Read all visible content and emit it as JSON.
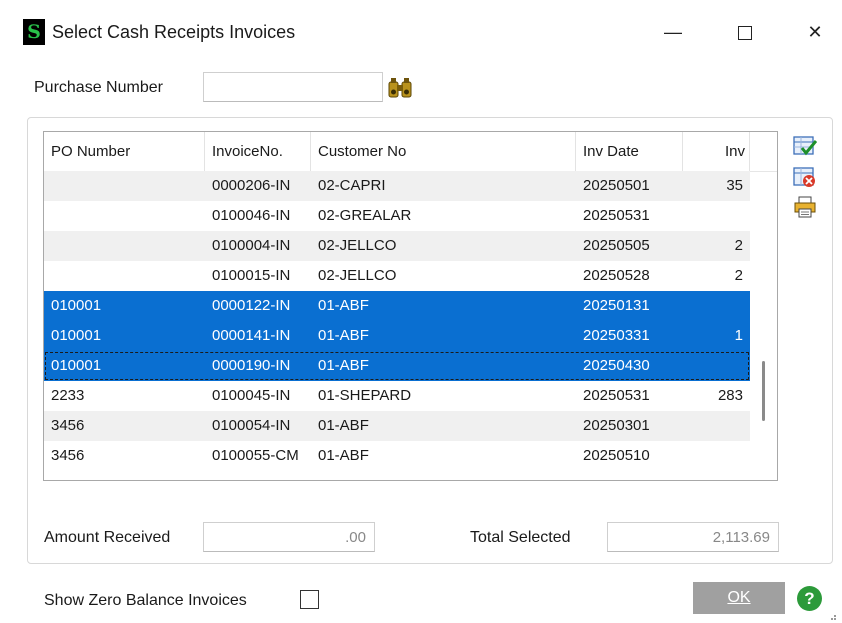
{
  "window": {
    "title": "Select Cash Receipts Invoices",
    "app_icon_glyph": "S",
    "minimize_glyph": "—",
    "close_glyph": "✕"
  },
  "search": {
    "label": "Purchase Number",
    "value": "",
    "lookup_icon": "binoculars-icon"
  },
  "grid": {
    "columns": [
      "PO Number",
      "InvoiceNo.",
      "Customer No",
      "Inv Date",
      "Inv"
    ],
    "rows": [
      {
        "po": "",
        "invoice": "0000206-IN",
        "customer": "02-CAPRI",
        "date": "20250501",
        "inv": "35",
        "selected": false
      },
      {
        "po": "",
        "invoice": "0100046-IN",
        "customer": "02-GREALAR",
        "date": "20250531",
        "inv": "",
        "selected": false
      },
      {
        "po": "",
        "invoice": "0100004-IN",
        "customer": "02-JELLCO",
        "date": "20250505",
        "inv": "2",
        "selected": false
      },
      {
        "po": "",
        "invoice": "0100015-IN",
        "customer": "02-JELLCO",
        "date": "20250528",
        "inv": "2",
        "selected": false
      },
      {
        "po": "010001",
        "invoice": "0000122-IN",
        "customer": "01-ABF",
        "date": "20250131",
        "inv": "",
        "selected": true
      },
      {
        "po": "010001",
        "invoice": "0000141-IN",
        "customer": "01-ABF",
        "date": "20250331",
        "inv": "1",
        "selected": true
      },
      {
        "po": "010001",
        "invoice": "0000190-IN",
        "customer": "01-ABF",
        "date": "20250430",
        "inv": "",
        "selected": true
      },
      {
        "po": "2233",
        "invoice": "0100045-IN",
        "customer": "01-SHEPARD",
        "date": "20250531",
        "inv": "283",
        "selected": false
      },
      {
        "po": "3456",
        "invoice": "0100054-IN",
        "customer": "01-ABF",
        "date": "20250301",
        "inv": "",
        "selected": false
      },
      {
        "po": "3456",
        "invoice": "0100055-CM",
        "customer": "01-ABF",
        "date": "20250510",
        "inv": "",
        "selected": false
      }
    ],
    "focused_row": 6
  },
  "side_buttons": [
    "select-all-check-icon",
    "clear-selection-icon",
    "print-icon"
  ],
  "totals": {
    "amount_received_label": "Amount Received",
    "amount_received_value": ".00",
    "total_selected_label": "Total Selected",
    "total_selected_value": "2,113.69"
  },
  "options": {
    "show_zero_balance_label": "Show Zero Balance Invoices",
    "show_zero_balance_checked": false
  },
  "buttons": {
    "ok_label": "OK",
    "help_glyph": "?"
  },
  "colors": {
    "selection": "#0a6fd1",
    "alt_row": "#f0f0f0",
    "ok_button": "#a0a0a0",
    "help": "#2c9a3a"
  }
}
